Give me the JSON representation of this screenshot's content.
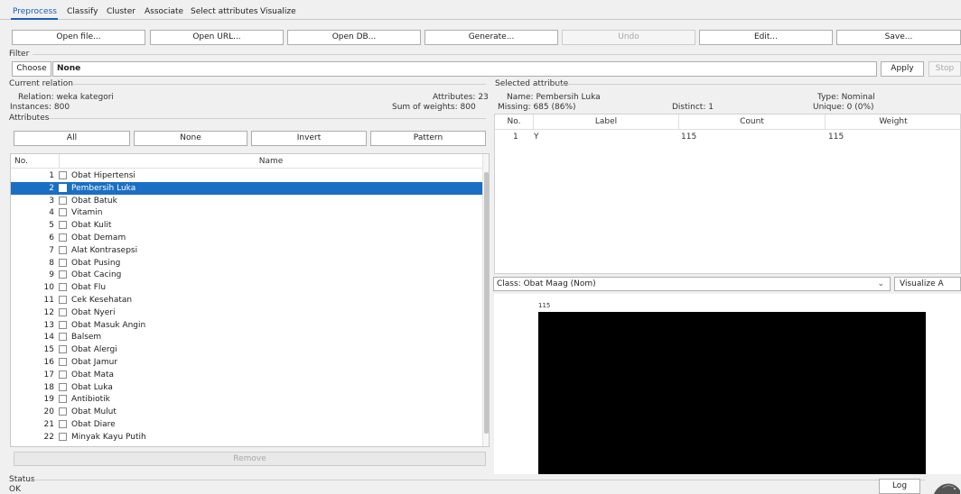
{
  "tabs": [
    "Preprocess",
    "Classify",
    "Cluster",
    "Associate",
    "Select attributes",
    "Visualize"
  ],
  "toolbar": {
    "open_file": "Open file...",
    "open_url": "Open URL...",
    "open_db": "Open DB...",
    "generate": "Generate...",
    "undo": "Undo",
    "edit": "Edit...",
    "save": "Save..."
  },
  "filter": {
    "section_label": "Filter",
    "choose_label": "Choose",
    "value": "None",
    "apply_label": "Apply",
    "stop_label": "Stop"
  },
  "current_relation": {
    "section_label": "Current relation",
    "relation": "Relation: weka kategori",
    "instances": "Instances: 800",
    "attributes": "Attributes: 23",
    "sum_of_weights": "Sum of weights: 800"
  },
  "attributes_panel": {
    "section_label": "Attributes",
    "all_label": "All",
    "none_label": "None",
    "invert_label": "Invert",
    "pattern_label": "Pattern",
    "col_no": "No.",
    "col_name": "Name",
    "remove_label": "Remove",
    "items": [
      {
        "no": "1",
        "name": "Obat Hipertensi"
      },
      {
        "no": "2",
        "name": "Pembersih Luka"
      },
      {
        "no": "3",
        "name": "Obat Batuk"
      },
      {
        "no": "4",
        "name": "Vitamin"
      },
      {
        "no": "5",
        "name": "Obat Kulit"
      },
      {
        "no": "6",
        "name": "Obat Demam"
      },
      {
        "no": "7",
        "name": "Alat Kontrasepsi"
      },
      {
        "no": "8",
        "name": "Obat Pusing"
      },
      {
        "no": "9",
        "name": "Obat Cacing"
      },
      {
        "no": "10",
        "name": "Obat Flu"
      },
      {
        "no": "11",
        "name": "Cek Kesehatan"
      },
      {
        "no": "12",
        "name": "Obat Nyeri"
      },
      {
        "no": "13",
        "name": " Obat Masuk Angin"
      },
      {
        "no": "14",
        "name": "Balsem"
      },
      {
        "no": "15",
        "name": "Obat Alergi"
      },
      {
        "no": "16",
        "name": "Obat Jamur"
      },
      {
        "no": "17",
        "name": "Obat Mata"
      },
      {
        "no": "18",
        "name": "Obat Luka"
      },
      {
        "no": "19",
        "name": "Antibiotik"
      },
      {
        "no": "20",
        "name": "Obat Mulut"
      },
      {
        "no": "21",
        "name": "Obat Diare"
      },
      {
        "no": "22",
        "name": "Minyak Kayu Putih"
      }
    ],
    "selected_index": 1
  },
  "selected_attribute": {
    "section_label": "Selected attribute",
    "name": "Name: Pembersih Luka",
    "type": "Type: Nominal",
    "missing": "Missing: 685 (86%)",
    "distinct": "Distinct: 1",
    "unique": "Unique: 0 (0%)",
    "col_no": "No.",
    "col_label": "Label",
    "col_count": "Count",
    "col_weight": "Weight",
    "rows": [
      {
        "no": "1",
        "label": "Y",
        "count": "115",
        "weight": "115"
      }
    ]
  },
  "class_select": {
    "value": "Class: Obat Maag (Nom)",
    "visualize_all": "Visualize A"
  },
  "histogram": {
    "bar_count_label": "115",
    "bar_color": "#000000",
    "value": 115
  },
  "status": {
    "section_label": "Status",
    "text": "OK",
    "log_label": "Log"
  },
  "colors": {
    "accent": "#1a5fb4",
    "selection": "#1a6fc4"
  }
}
